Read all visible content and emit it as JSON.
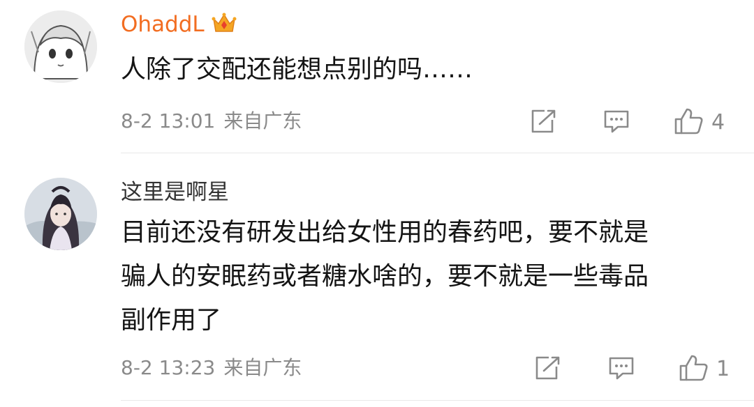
{
  "comments": [
    {
      "username": "OhaddL",
      "text_lines": [
        "人除了交配还能想点别的吗……"
      ],
      "date": "8-2 13:01",
      "location": "来自广东",
      "like_count": "4",
      "icons": {
        "share": "share-icon",
        "comment": "comment-icon",
        "like": "thumbs-up-icon",
        "badge": "crown-icon"
      },
      "colors": {
        "username": "#f26d21"
      }
    },
    {
      "username": "这里是啊星",
      "text_lines": [
        "目前还没有研发出给女性用的春药吧，要不就是",
        "骗人的安眠药或者糖水啥的，要不就是一些毒品",
        "副作用了"
      ],
      "date": "8-2 13:23",
      "location": "来自广东",
      "like_count": "1",
      "icons": {
        "share": "share-icon",
        "comment": "comment-icon",
        "like": "thumbs-up-icon"
      },
      "colors": {
        "username": "#333333"
      }
    }
  ]
}
